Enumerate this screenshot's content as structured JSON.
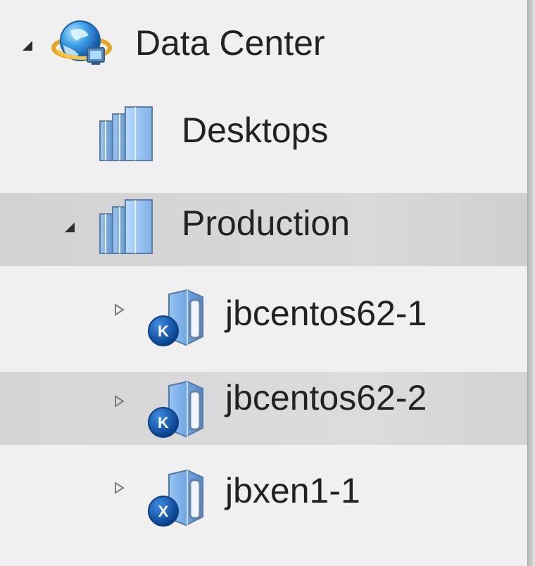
{
  "tree": {
    "nodes": [
      {
        "label": "Data Center",
        "icon": "globe-icon",
        "expanded": true
      },
      {
        "label": "Desktops",
        "icon": "server-rack-icon"
      },
      {
        "label": "Production",
        "icon": "server-rack-icon",
        "expanded": true,
        "selected": true
      },
      {
        "label": "jbcentos62-1",
        "icon": "kvm-host-icon",
        "badge": "K",
        "expanded": false
      },
      {
        "label": "jbcentos62-2",
        "icon": "kvm-host-icon",
        "badge": "K",
        "expanded": false,
        "hovered": true
      },
      {
        "label": "jbxen1-1",
        "icon": "xen-host-icon",
        "badge": "X",
        "expanded": false
      }
    ]
  },
  "colors": {
    "background": "#f0f0f0",
    "selected_row": "#d8d8d8",
    "text": "#222222",
    "badge_blue": "#0f4f9c",
    "rack_blue": "#5f95d6"
  }
}
